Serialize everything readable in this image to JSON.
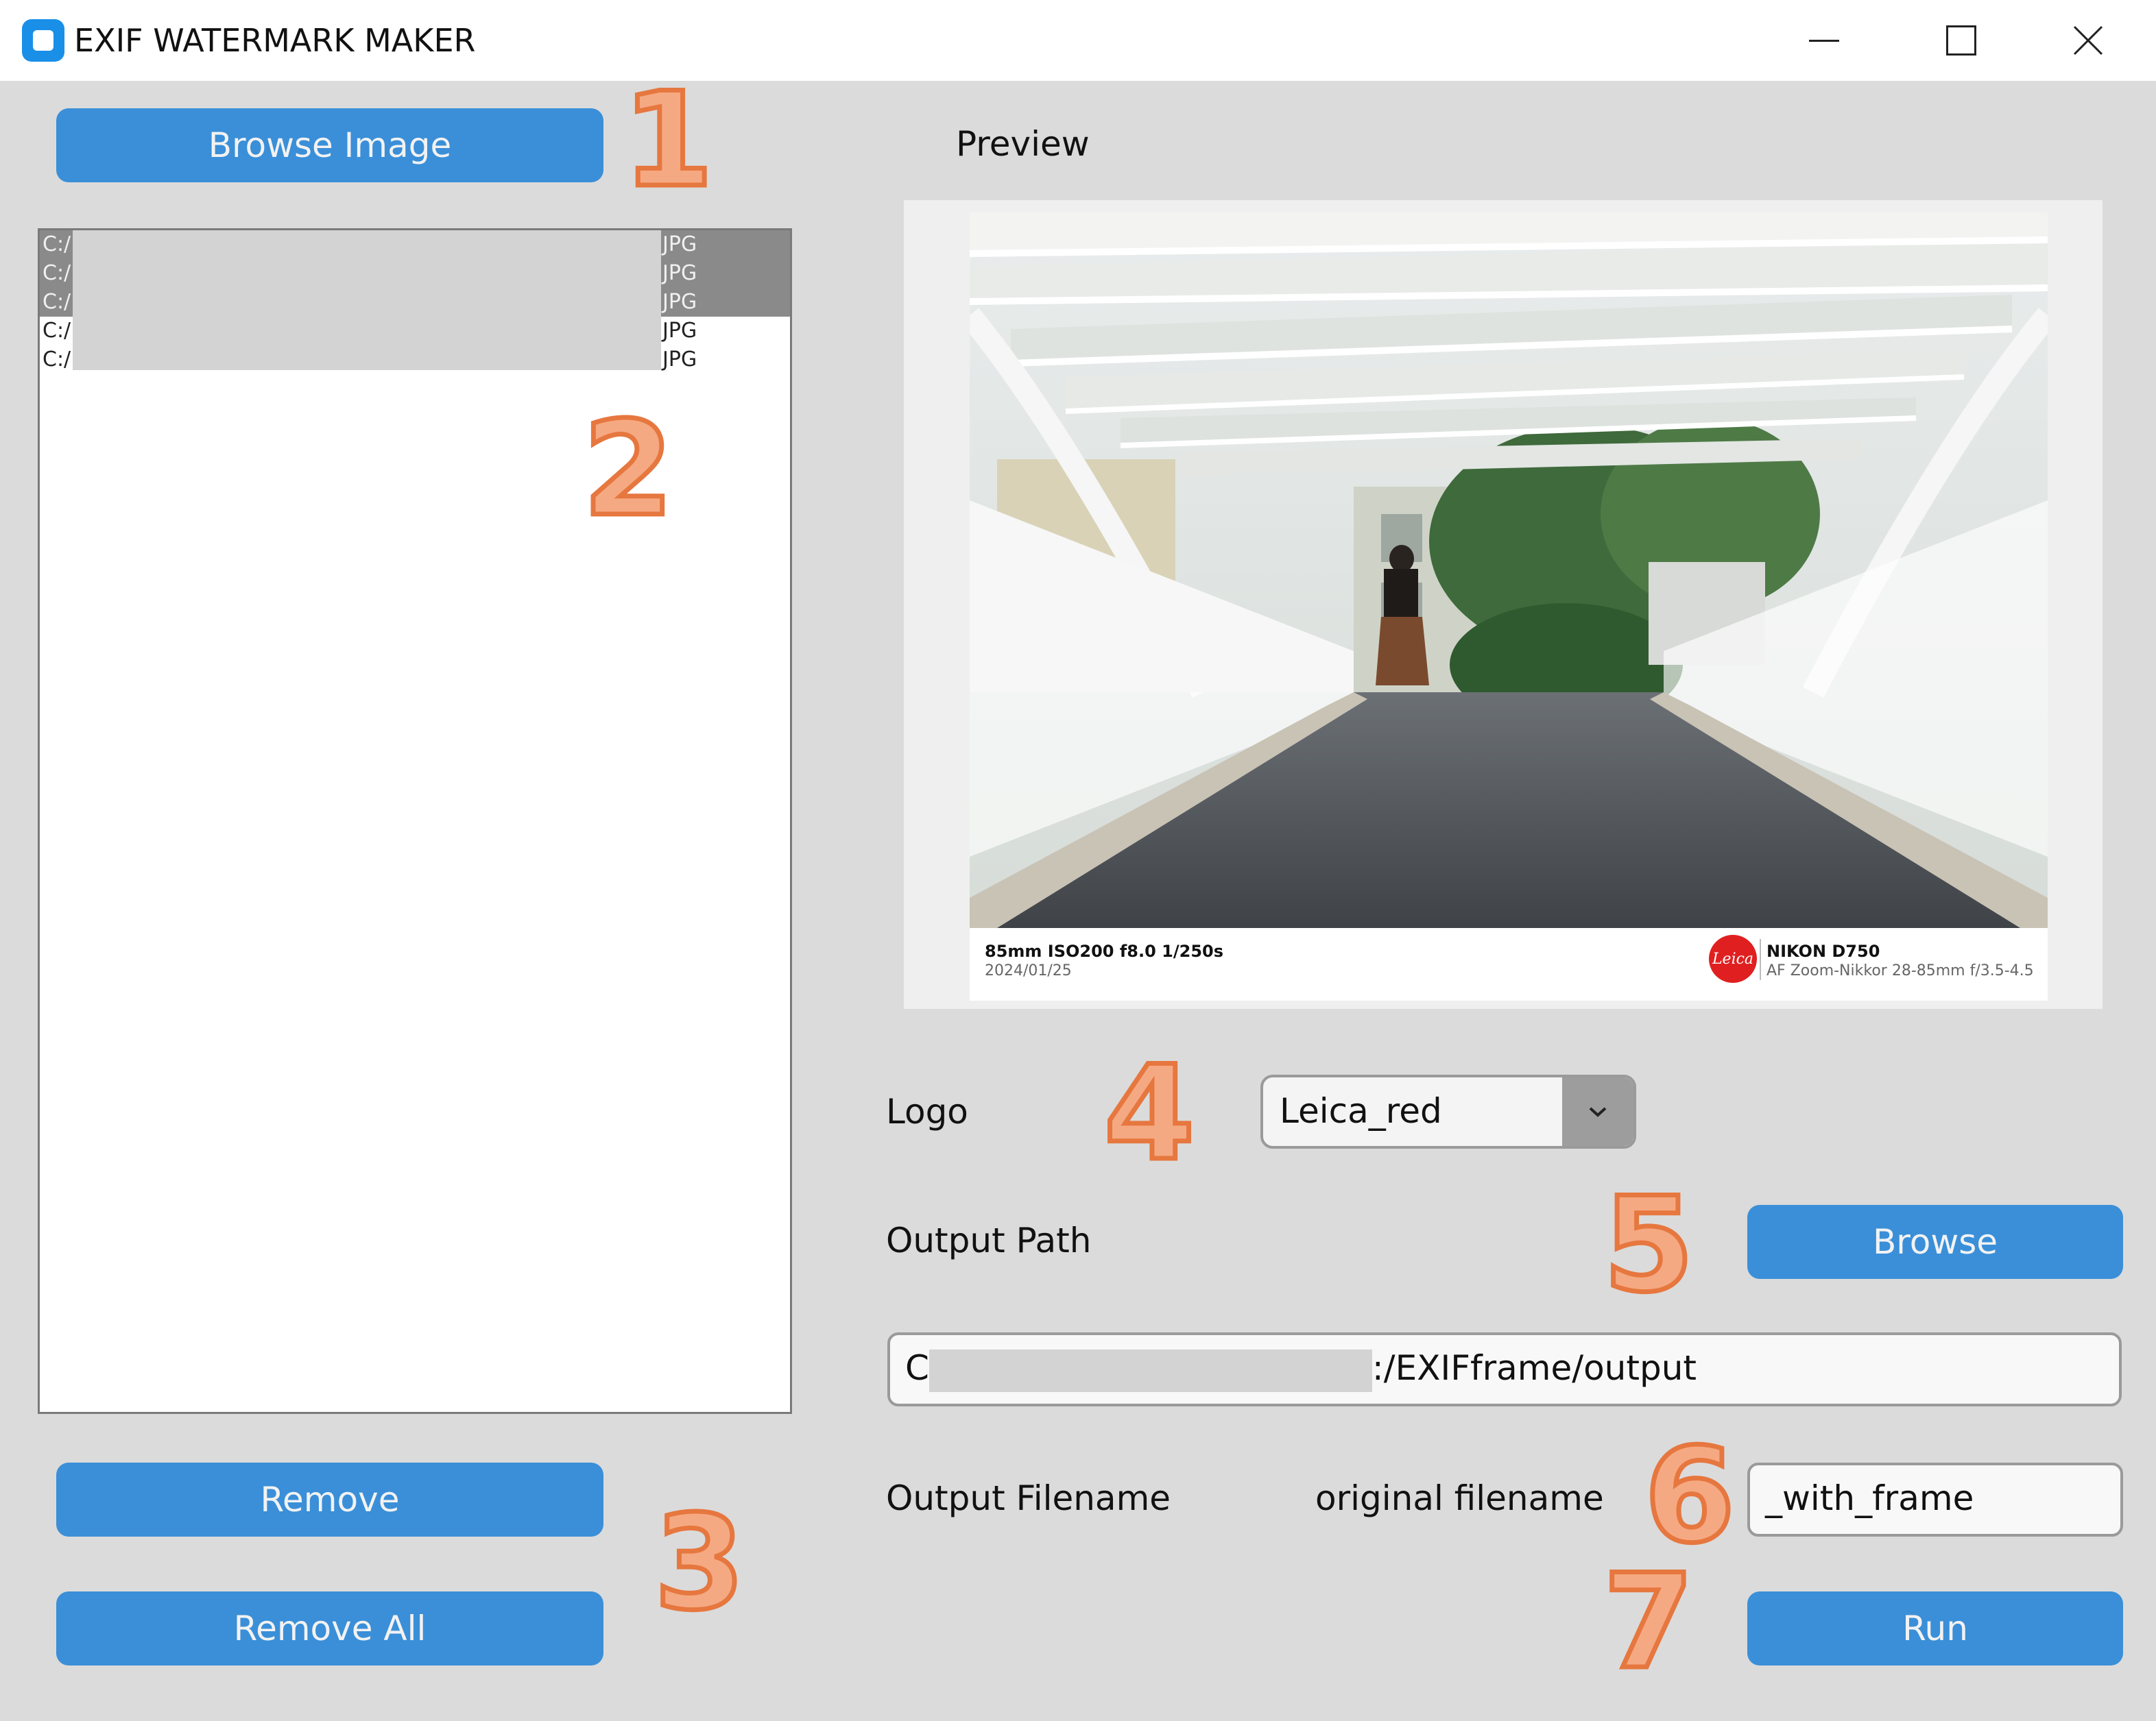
{
  "window": {
    "title": "EXIF WATERMARK MAKER",
    "controls": [
      "minimize",
      "maximize",
      "close"
    ]
  },
  "left_panel": {
    "browse_button": "Browse Image",
    "files": [
      {
        "prefix": "C:/",
        "suffix": "JPG",
        "selected": true
      },
      {
        "prefix": "C:/",
        "suffix": "JPG",
        "selected": true
      },
      {
        "prefix": "C:/",
        "suffix": "JPG",
        "selected": true
      },
      {
        "prefix": "C:/",
        "suffix": "JPG",
        "selected": false
      },
      {
        "prefix": "C:/",
        "suffix": "JPG",
        "selected": false
      }
    ],
    "remove_button": "Remove",
    "remove_all_button": "Remove All"
  },
  "preview": {
    "label": "Preview",
    "exif": {
      "settings": "85mm  ISO200  f8.0  1/250s",
      "date": "2024/01/25",
      "camera": "NIKON D750",
      "lens": "AF Zoom-Nikkor 28-85mm f/3.5-4.5",
      "logo_text": "Leica"
    }
  },
  "logo": {
    "label": "Logo",
    "selected": "Leica_red"
  },
  "output": {
    "path_label": "Output Path",
    "browse_button": "Browse",
    "path_prefix": "C",
    "path_suffix": ":/EXIFframe/output",
    "filename_label": "Output Filename",
    "filename_base": "original filename",
    "filename_suffix": "_with_frame",
    "run_button": "Run"
  },
  "annotations": [
    "1",
    "2",
    "3",
    "4",
    "5",
    "6",
    "7"
  ],
  "colors": {
    "button": "#3a8fd8",
    "annotation_fill": "#f5a982",
    "annotation_stroke": "#e6773f"
  }
}
